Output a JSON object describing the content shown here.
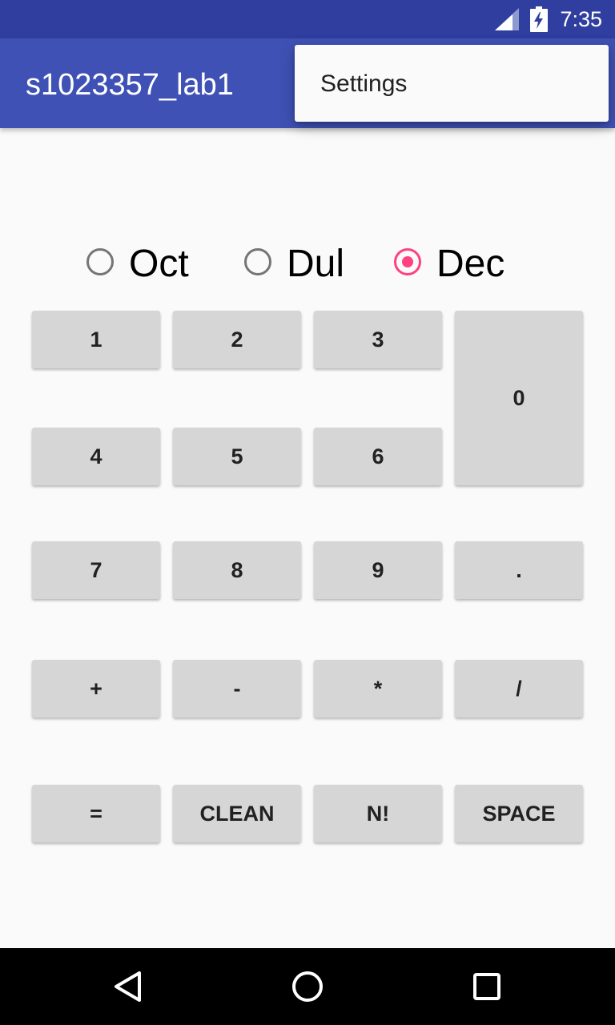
{
  "status_bar": {
    "time": "7:35",
    "icons": [
      "signal-icon",
      "battery-charging-icon"
    ]
  },
  "app_bar": {
    "title": "s1023357_lab1"
  },
  "overflow_menu": {
    "items": [
      {
        "label": "Settings"
      }
    ]
  },
  "radix": {
    "options": [
      {
        "label": "Oct",
        "checked": false
      },
      {
        "label": "Dul",
        "checked": false
      },
      {
        "label": "Dec",
        "checked": true
      }
    ]
  },
  "keypad": {
    "keys": [
      "1",
      "2",
      "3",
      "0",
      "4",
      "5",
      "6",
      "7",
      "8",
      "9",
      ".",
      "+",
      "-",
      "*",
      "/",
      "=",
      "CLEAN",
      "N!",
      "SPACE"
    ]
  },
  "nav_bar": {
    "icons": [
      "back-icon",
      "home-icon",
      "recents-icon"
    ]
  },
  "colors": {
    "status_bar": "#303f9f",
    "app_bar": "#3f51b5",
    "accent": "#ff4081",
    "key_background": "#d6d6d6",
    "background": "#fafafa"
  }
}
